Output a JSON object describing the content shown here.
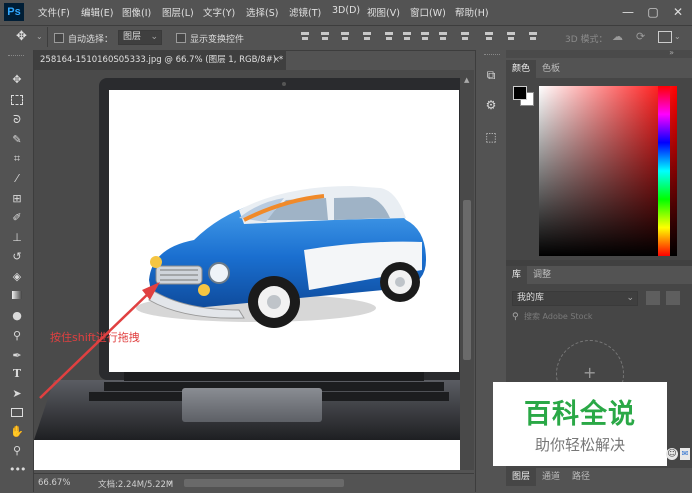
{
  "app": {
    "logo": "Ps"
  },
  "menu": [
    "文件(F)",
    "编辑(E)",
    "图像(I)",
    "图层(L)",
    "文字(Y)",
    "选择(S)",
    "滤镜(T)",
    "3D(D)",
    "视图(V)",
    "窗口(W)",
    "帮助(H)"
  ],
  "window_controls": {
    "minimize": "—",
    "maximize": "▢",
    "close": "✕"
  },
  "options": {
    "auto_select_label": "自动选择：",
    "auto_select_value": "图层",
    "show_transform_label": "显示变换控件",
    "mode3d_label": "3D 模式："
  },
  "document": {
    "tab_title": "258164-1510160S05333.jpg @ 66.7% (图层 1, RGB/8#) *",
    "tab_close": "×",
    "annotation": "按住shift进行拖拽"
  },
  "status": {
    "zoom": "66.67%",
    "doc_info": "文档:2.24M/5.22M",
    "arrow": "›"
  },
  "panels": {
    "color_tabs": [
      "颜色",
      "色板"
    ],
    "library_tabs": [
      "库",
      "调整"
    ],
    "library_select": "我的库",
    "library_search_placeholder": "搜索 Adobe Stock",
    "layers_tabs": [
      "图层",
      "通道",
      "路径"
    ]
  },
  "watermark": {
    "title": "百科全说",
    "subtitle": "助你轻松解决"
  },
  "colors": {
    "accent_red": "#e04040",
    "brand_green": "#2aa846",
    "ps_blue": "#31a8ff"
  },
  "icons": [
    "move-icon",
    "marquee-icon",
    "lasso-icon",
    "quick-select-icon",
    "crop-icon",
    "eyedropper-icon",
    "healing-brush-icon",
    "brush-icon",
    "clone-stamp-icon",
    "history-brush-icon",
    "eraser-icon",
    "gradient-icon",
    "blur-icon",
    "dodge-icon",
    "pen-icon",
    "type-icon",
    "path-select-icon",
    "rectangle-icon",
    "hand-icon",
    "zoom-icon",
    "more-tools-icon"
  ]
}
